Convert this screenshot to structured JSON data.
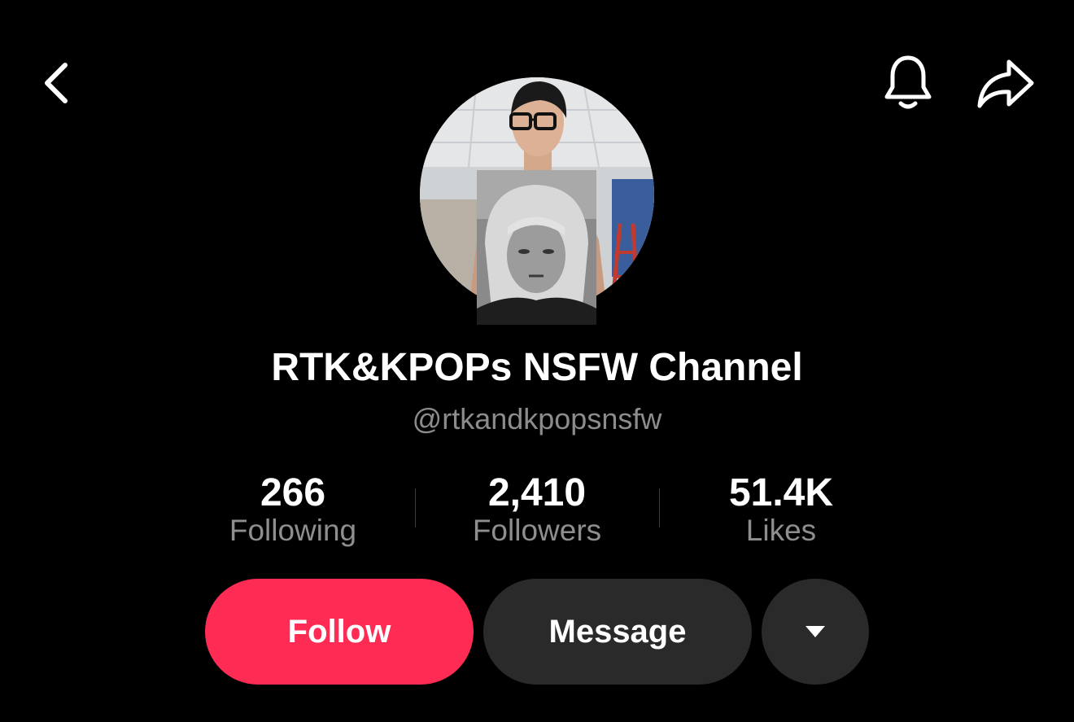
{
  "header": {
    "back_icon": "chevron-left-icon",
    "bell_icon": "bell-icon",
    "share_icon": "share-arrow-icon"
  },
  "profile": {
    "display_name": "RTK&KPOPs NSFW Channel",
    "handle": "@rtkandkpopsnsfw"
  },
  "stats": [
    {
      "value": "266",
      "label": "Following"
    },
    {
      "value": "2,410",
      "label": "Followers"
    },
    {
      "value": "51.4K",
      "label": "Likes"
    }
  ],
  "actions": {
    "follow_label": "Follow",
    "message_label": "Message",
    "more_icon": "caret-down-icon"
  },
  "colors": {
    "background": "#000000",
    "follow_accent": "#fe2c55",
    "secondary_button": "#2a2a2a",
    "muted_text": "#8c8c8c"
  }
}
